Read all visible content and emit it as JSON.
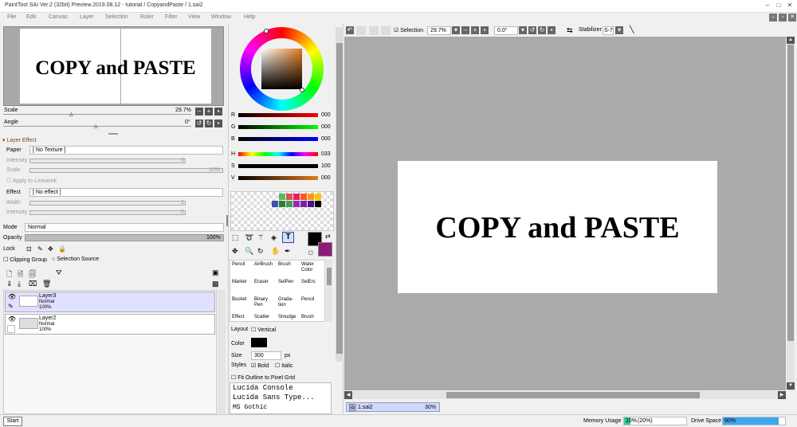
{
  "title": "PaintTool SAI Ver.2 (32bit) Preview.2019.08.12 - tutorial / CopyandPaste / 1.sai2",
  "menu": [
    "File",
    "Edit",
    "Canvas",
    "Layer",
    "Selection",
    "Ruler",
    "Filter",
    "View",
    "Window",
    "Help"
  ],
  "canvas_text": "COPY and PASTE",
  "navigator": {
    "scale_label": "Scale",
    "scale_value": "29.7%",
    "angle_label": "Angle",
    "angle_value": "0°"
  },
  "layer_effect": {
    "header": "Layer Effect",
    "paper_label": "Paper",
    "paper_value": "[ No Texture ]",
    "intensity_label": "Intensity",
    "intensity_value": "0",
    "scale_label": "Scale",
    "scale_value": "10%",
    "apply_linework": "Apply to Linework",
    "effect_label": "Effect",
    "effect_value": "[ No effect ]",
    "width_label": "Width",
    "width_value": "1",
    "intensity2_label": "Intensity",
    "intensity2_value": "0"
  },
  "layers_panel": {
    "mode_label": "Mode",
    "mode_value": "Normal",
    "opacity_label": "Opacity",
    "opacity_value": "100%",
    "lock_label": "Lock",
    "clipping_group": "Clipping Group",
    "selection_source": "Selection Source",
    "layers": [
      {
        "name": "Layer3",
        "mode": "Normal",
        "opacity": "100%",
        "selected": true
      },
      {
        "name": "Layer2",
        "mode": "Normal",
        "opacity": "100%",
        "selected": false
      }
    ]
  },
  "color": {
    "sliders": [
      {
        "label": "R",
        "value": "000"
      },
      {
        "label": "G",
        "value": "000"
      },
      {
        "label": "B",
        "value": "000"
      },
      {
        "label": "H",
        "value": "033"
      },
      {
        "label": "S",
        "value": "100"
      },
      {
        "label": "V",
        "value": "000"
      }
    ],
    "palette": [
      "#5cb85c",
      "#d9534f",
      "#e91e63",
      "#ff5722",
      "#ff9800",
      "#ffc107",
      "#3f51b5",
      "#2e7d32",
      "#43a047",
      "#9c27b0",
      "#7b1fa2",
      "#4a148c",
      "#1a237e",
      "#000000"
    ],
    "main_color": "#000000",
    "sub_color": "#8e1b7a"
  },
  "tools": [
    [
      "Pencil",
      "AirBrush",
      "Brush",
      "Water Color"
    ],
    [
      "Marker",
      "Eraser",
      "SelPen",
      "SelErs"
    ],
    [
      "Bucket",
      "Binary Pen",
      "Grada-tion",
      "Pencil"
    ],
    [
      "Effect",
      "Scatter",
      "Smudge",
      "Brush"
    ]
  ],
  "text_tool": {
    "layout_label": "Layout",
    "vertical": "Vertical",
    "color_label": "Color",
    "size_label": "Size",
    "size_value": "300",
    "size_unit": "px",
    "styles_label": "Styles",
    "bold": "Bold",
    "italic": "Italic",
    "fit_outline": "Fit Outline to Pixel Grid",
    "fonts": [
      "Lucida Console",
      "Lucida Sans Type...",
      "MS Gothic"
    ]
  },
  "toolbar": {
    "selection_label": "Selection",
    "zoom_value": "29.7%",
    "angle_value": "0.0°",
    "stabilizer_label": "Stabilizer",
    "stabilizer_value": "S-7"
  },
  "doc_tab": {
    "name": "1.sai2",
    "zoom": "30%"
  },
  "status": {
    "start": "Start",
    "memory_label": "Memory Usage",
    "memory_value": "10%",
    "memory_paren": "(20%)",
    "drive_label": "Drive Space",
    "drive_value": "90%",
    "memory_fraction": 0.1,
    "drive_fraction": 0.9
  }
}
